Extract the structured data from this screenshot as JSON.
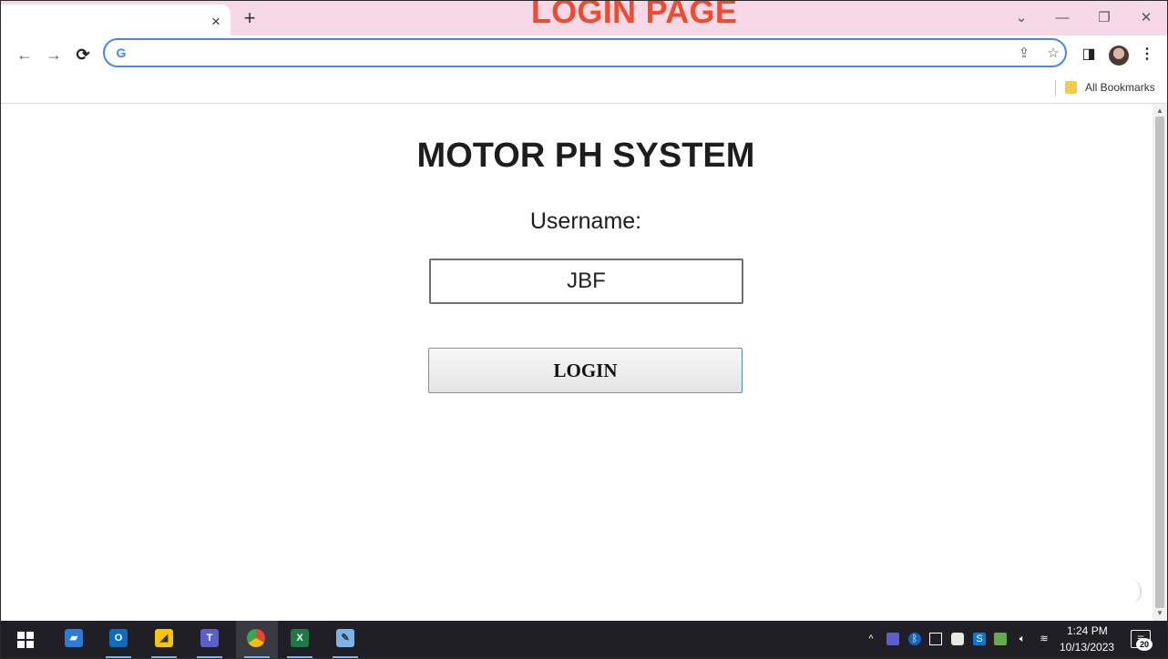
{
  "browser": {
    "page_banner": "LOGIN PAGE",
    "tab_close": "×",
    "new_tab": "+",
    "window_controls": {
      "chevron": "⌄",
      "minimize": "—",
      "restore": "❐",
      "close": "✕"
    },
    "nav": {
      "back": "←",
      "forward": "→",
      "reload": "⟳"
    },
    "omnibox": {
      "value": "",
      "g_glyph": "G"
    },
    "bookmarks": {
      "label": "All Bookmarks"
    }
  },
  "page": {
    "title": "MOTOR PH SYSTEM",
    "username_label": "Username:",
    "username_value": "JBF",
    "login_label": "LOGIN"
  },
  "taskbar": {
    "apps": [
      "windows-start",
      "file-explorer",
      "outlook",
      "sticky-notes",
      "teams",
      "chrome",
      "excel",
      "paint"
    ],
    "clock_time": "1:24 PM",
    "clock_date": "10/13/2023",
    "notification_count": "20"
  },
  "colors": {
    "tab_strip": "#f6d8e6",
    "banner": "#f04b2f",
    "omnibox_border": "#4a86e8",
    "taskbar": "#1f1f25"
  }
}
